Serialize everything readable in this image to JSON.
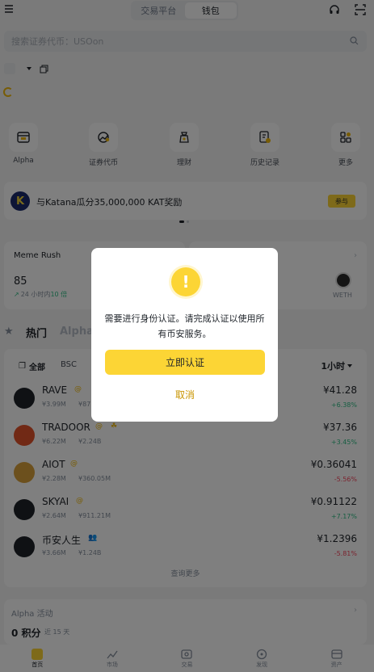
{
  "top": {
    "tabs": [
      "交易平台",
      "钱包"
    ],
    "active_tab": 1
  },
  "search": {
    "placeholder": "搜索证券代币：USOon"
  },
  "quick_actions": [
    {
      "label": "Alpha",
      "icon": "alpha-icon"
    },
    {
      "label": "证券代币",
      "icon": "tokenized-stocks-icon"
    },
    {
      "label": "理财",
      "icon": "earn-icon"
    },
    {
      "label": "历史记录",
      "icon": "history-icon"
    },
    {
      "label": "更多",
      "icon": "more-icon"
    }
  ],
  "banner": {
    "text": "与Katana瓜分35,000,000 KAT奖励",
    "button": "参与"
  },
  "meme": {
    "title": "Meme Rush",
    "value": "85",
    "note_prefix": "24 小时内",
    "note_highlight": "10 倍",
    "token": "WETH"
  },
  "hot": {
    "title": "热门",
    "second": "Alpha"
  },
  "filters": {
    "all": "全部",
    "chain": "BSC",
    "timeframe": "1小时"
  },
  "tokens": [
    {
      "name": "RAVE",
      "vol": "¥3.99M",
      "mcap": "¥87",
      "price": "¥41.28",
      "change": "+6.38%",
      "dir": "up",
      "logo_color": "#1e2329"
    },
    {
      "name": "TRADOOR",
      "vol": "¥6.22M",
      "mcap": "¥2.24B",
      "price": "¥37.36",
      "change": "+3.45%",
      "dir": "up",
      "logo_color": "#e2532b"
    },
    {
      "name": "AIOT",
      "vol": "¥2.28M",
      "mcap": "¥360.05M",
      "price": "¥0.36041",
      "change": "-5.56%",
      "dir": "down",
      "logo_color": "#d9a13b"
    },
    {
      "name": "SKYAI",
      "vol": "¥2.64M",
      "mcap": "¥911.21M",
      "price": "¥0.91122",
      "change": "+7.17%",
      "dir": "up",
      "logo_color": "#1e2329"
    },
    {
      "name": "币安人生",
      "vol": "¥3.66M",
      "mcap": "¥1.24B",
      "price": "¥1.2396",
      "change": "-5.81%",
      "dir": "down",
      "logo_color": "#1e2329"
    }
  ],
  "view_more": "查询更多",
  "alpha_activity": {
    "title": "Alpha 活动",
    "points": "0 积分",
    "period": "近 15 天"
  },
  "nav": [
    {
      "label": "首页",
      "icon": "home-icon"
    },
    {
      "label": "市场",
      "icon": "markets-icon"
    },
    {
      "label": "交易",
      "icon": "trade-icon"
    },
    {
      "label": "发现",
      "icon": "discover-icon"
    },
    {
      "label": "资产",
      "icon": "assets-icon"
    }
  ],
  "dialog": {
    "message": "需要进行身份认证。请完成认证以使用所有币安服务。",
    "confirm": "立即认证",
    "cancel": "取消"
  },
  "colors": {
    "brand": "#fcd535",
    "up": "#2ebd85",
    "down": "#f6465d",
    "link": "#c99400"
  }
}
